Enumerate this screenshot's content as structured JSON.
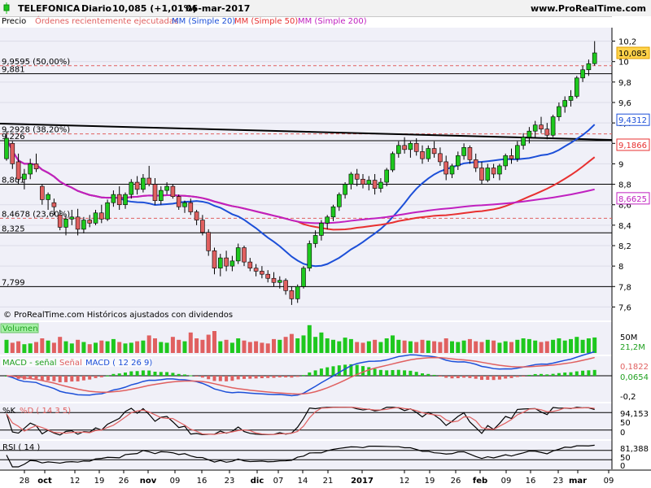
{
  "header": {
    "symbol": "TELEFONICA",
    "period": "Diario",
    "quote": "10,085 (+1,01%)",
    "date": "06-mar-2017",
    "site": "www.ProRealTime.com"
  },
  "price_legend": {
    "price": "Precio",
    "orders": "Órdenes recientemente ejecutadas",
    "ma20": "MM (Simple 20)",
    "ma50": "MM (Simple 50)",
    "ma200": "MM (Simple 200)"
  },
  "copyright": "© ProRealTime.com Históricos ajustados con dividendos",
  "colors": {
    "up": "#1ec81e",
    "down": "#e06060",
    "ma20": "#1c4fd8",
    "ma50": "#e83030",
    "ma200": "#c020c0",
    "volume": "#1ec81e",
    "grid": "#000000"
  },
  "levels": [
    {
      "text": "9,9595 (50,00%)",
      "value": 9.9595,
      "style": "dashed-red"
    },
    {
      "text": "9,881",
      "value": 9.881,
      "style": "solid-black"
    },
    {
      "text": "9,2928 (38,20%)",
      "value": 9.2928,
      "style": "dashed-red"
    },
    {
      "text": "9,226",
      "value": 9.226,
      "style": "solid-black"
    },
    {
      "text": "8,801",
      "value": 8.801,
      "style": "solid-black"
    },
    {
      "text": "8,4678 (23,60%)",
      "value": 8.4678,
      "style": "dashed-red"
    },
    {
      "text": "8,325",
      "value": 8.325,
      "style": "solid-black"
    },
    {
      "text": "7,799",
      "value": 7.799,
      "style": "solid-black"
    }
  ],
  "price_axis": {
    "ticks": [
      "10,2",
      "10",
      "9,8",
      "9,6",
      "9,4",
      "9,2",
      "9",
      "8,8",
      "8,6",
      "8,4",
      "8,2",
      "8",
      "7,8",
      "7,6"
    ],
    "values": [
      10.2,
      10.0,
      9.8,
      9.6,
      9.4,
      9.2,
      9.0,
      8.8,
      8.6,
      8.4,
      8.2,
      8.0,
      7.8,
      7.6
    ],
    "labels": [
      {
        "text": "10,085",
        "value": 10.085,
        "color": "#e0a000",
        "fill": "#ffd24a",
        "textcolor": "#000000"
      },
      {
        "text": "9,4312",
        "value": 9.4312,
        "color": "#1c4fd8",
        "fill": "#ffffff",
        "textcolor": "#1c4fd8"
      },
      {
        "text": "9,1866",
        "value": 9.1866,
        "color": "#e83030",
        "fill": "#ffffff",
        "textcolor": "#e83030"
      },
      {
        "text": "8,6625",
        "value": 8.6625,
        "color": "#c020c0",
        "fill": "#ffffff",
        "textcolor": "#c020c0"
      }
    ]
  },
  "volume": {
    "label": "Volumen",
    "tick": "50M",
    "value": "21,2M"
  },
  "macd": {
    "label_main": "MACD - señal",
    "label_signal": "Señal",
    "label_macd": "MACD ( 12 26 9)",
    "tick_zero": "0",
    "tick_neg": "-0,2",
    "value1": "0,1822",
    "value2": "0,0654"
  },
  "stoch": {
    "label_k": "%K",
    "label_d": "%D ( 14 3 5)",
    "value": "94,153",
    "tick_hi": "50",
    "tick_lo": "0"
  },
  "rsi": {
    "label": "RSI ( 14 )",
    "value": "81,388",
    "tick_hi": "50",
    "tick_lo": "0"
  },
  "date_axis": [
    "28",
    "oct",
    "12",
    "19",
    "26",
    "nov",
    "09",
    "16",
    "23",
    "dic",
    "07",
    "14",
    "21",
    "2017",
    "12",
    "19",
    "26",
    "feb",
    "09",
    "16",
    "23",
    "mar",
    "09"
  ],
  "chart_data": {
    "type": "candlestick",
    "ylim": [
      7.5,
      10.3
    ],
    "candles": [
      [
        9.05,
        9.32,
        9.03,
        9.25
      ],
      [
        9.2,
        9.22,
        8.95,
        9.0
      ],
      [
        9.02,
        9.1,
        8.8,
        8.85
      ],
      [
        8.85,
        8.95,
        8.75,
        8.9
      ],
      [
        8.9,
        9.05,
        8.85,
        9.0
      ],
      [
        9.0,
        9.1,
        8.92,
        8.95
      ],
      [
        8.78,
        8.8,
        8.6,
        8.65
      ],
      [
        8.65,
        8.72,
        8.55,
        8.7
      ],
      [
        8.62,
        8.66,
        8.5,
        8.58
      ],
      [
        8.5,
        8.55,
        8.35,
        8.38
      ],
      [
        8.38,
        8.5,
        8.3,
        8.46
      ],
      [
        8.46,
        8.55,
        8.4,
        8.48
      ],
      [
        8.48,
        8.56,
        8.3,
        8.36
      ],
      [
        8.36,
        8.48,
        8.32,
        8.45
      ],
      [
        8.45,
        8.5,
        8.38,
        8.42
      ],
      [
        8.42,
        8.55,
        8.4,
        8.52
      ],
      [
        8.52,
        8.6,
        8.42,
        8.46
      ],
      [
        8.46,
        8.65,
        8.44,
        8.62
      ],
      [
        8.62,
        8.74,
        8.58,
        8.7
      ],
      [
        8.7,
        8.78,
        8.55,
        8.6
      ],
      [
        8.6,
        8.72,
        8.56,
        8.7
      ],
      [
        8.7,
        8.85,
        8.66,
        8.82
      ],
      [
        8.82,
        8.88,
        8.7,
        8.75
      ],
      [
        8.75,
        8.9,
        8.72,
        8.86
      ],
      [
        8.86,
        8.98,
        8.78,
        8.8
      ],
      [
        8.8,
        8.86,
        8.6,
        8.64
      ],
      [
        8.64,
        8.78,
        8.6,
        8.74
      ],
      [
        8.74,
        8.82,
        8.7,
        8.78
      ],
      [
        8.78,
        8.8,
        8.66,
        8.68
      ],
      [
        8.68,
        8.7,
        8.55,
        8.58
      ],
      [
        8.58,
        8.64,
        8.52,
        8.62
      ],
      [
        8.62,
        8.66,
        8.5,
        8.53
      ],
      [
        8.53,
        8.55,
        8.4,
        8.45
      ],
      [
        8.45,
        8.5,
        8.3,
        8.33
      ],
      [
        8.33,
        8.36,
        8.1,
        8.15
      ],
      [
        8.15,
        8.18,
        7.92,
        7.98
      ],
      [
        7.98,
        8.12,
        7.9,
        8.08
      ],
      [
        8.08,
        8.15,
        7.95,
        8.0
      ],
      [
        8.0,
        8.1,
        7.95,
        8.05
      ],
      [
        8.05,
        8.22,
        8.02,
        8.18
      ],
      [
        8.18,
        8.2,
        8.0,
        8.04
      ],
      [
        8.04,
        8.08,
        7.95,
        7.98
      ],
      [
        7.98,
        8.02,
        7.9,
        7.95
      ],
      [
        7.95,
        8.0,
        7.88,
        7.92
      ],
      [
        7.92,
        7.96,
        7.84,
        7.88
      ],
      [
        7.88,
        7.94,
        7.8,
        7.84
      ],
      [
        7.84,
        7.9,
        7.78,
        7.86
      ],
      [
        7.86,
        7.88,
        7.72,
        7.76
      ],
      [
        7.76,
        7.8,
        7.62,
        7.68
      ],
      [
        7.68,
        7.82,
        7.64,
        7.8
      ],
      [
        7.8,
        8.0,
        7.78,
        7.98
      ],
      [
        7.98,
        8.25,
        7.95,
        8.22
      ],
      [
        8.22,
        8.35,
        8.18,
        8.3
      ],
      [
        8.3,
        8.45,
        8.25,
        8.42
      ],
      [
        8.42,
        8.5,
        8.36,
        8.48
      ],
      [
        8.48,
        8.6,
        8.44,
        8.58
      ],
      [
        8.58,
        8.72,
        8.54,
        8.7
      ],
      [
        8.7,
        8.82,
        8.66,
        8.8
      ],
      [
        8.8,
        8.92,
        8.75,
        8.9
      ],
      [
        8.9,
        8.95,
        8.78,
        8.85
      ],
      [
        8.85,
        8.9,
        8.76,
        8.8
      ],
      [
        8.8,
        8.88,
        8.74,
        8.84
      ],
      [
        8.84,
        8.9,
        8.7,
        8.76
      ],
      [
        8.76,
        8.86,
        8.72,
        8.82
      ],
      [
        8.82,
        8.96,
        8.78,
        8.94
      ],
      [
        8.94,
        9.12,
        8.92,
        9.1
      ],
      [
        9.1,
        9.22,
        9.06,
        9.18
      ],
      [
        9.18,
        9.26,
        9.1,
        9.14
      ],
      [
        9.14,
        9.22,
        9.06,
        9.2
      ],
      [
        9.2,
        9.25,
        9.08,
        9.12
      ],
      [
        9.12,
        9.18,
        9.0,
        9.05
      ],
      [
        9.05,
        9.18,
        9.02,
        9.15
      ],
      [
        9.15,
        9.22,
        9.06,
        9.1
      ],
      [
        9.1,
        9.16,
        8.98,
        9.02
      ],
      [
        9.02,
        9.08,
        8.84,
        8.9
      ],
      [
        8.9,
        9.0,
        8.86,
        8.98
      ],
      [
        8.98,
        9.12,
        8.94,
        9.08
      ],
      [
        9.08,
        9.2,
        9.04,
        9.16
      ],
      [
        9.16,
        9.18,
        9.0,
        9.04
      ],
      [
        9.04,
        9.1,
        8.92,
        8.96
      ],
      [
        8.96,
        9.02,
        8.8,
        8.84
      ],
      [
        8.84,
        9.0,
        8.82,
        8.96
      ],
      [
        8.96,
        9.0,
        8.86,
        8.9
      ],
      [
        8.9,
        9.0,
        8.84,
        8.98
      ],
      [
        8.98,
        9.1,
        8.94,
        9.08
      ],
      [
        9.08,
        9.15,
        9.0,
        9.05
      ],
      [
        9.05,
        9.22,
        9.02,
        9.18
      ],
      [
        9.18,
        9.3,
        9.14,
        9.26
      ],
      [
        9.26,
        9.36,
        9.2,
        9.32
      ],
      [
        9.32,
        9.42,
        9.26,
        9.38
      ],
      [
        9.38,
        9.46,
        9.3,
        9.34
      ],
      [
        9.34,
        9.4,
        9.24,
        9.28
      ],
      [
        9.28,
        9.48,
        9.26,
        9.46
      ],
      [
        9.46,
        9.6,
        9.42,
        9.56
      ],
      [
        9.56,
        9.66,
        9.5,
        9.62
      ],
      [
        9.62,
        9.72,
        9.56,
        9.66
      ],
      [
        9.66,
        9.86,
        9.64,
        9.84
      ],
      [
        9.84,
        9.96,
        9.8,
        9.92
      ],
      [
        9.92,
        10.02,
        9.86,
        9.98
      ],
      [
        9.98,
        10.2,
        9.96,
        10.085
      ]
    ],
    "volume": [
      18,
      14,
      16,
      12,
      13,
      15,
      20,
      17,
      14,
      22,
      16,
      13,
      18,
      15,
      12,
      14,
      17,
      16,
      19,
      15,
      13,
      14,
      16,
      17,
      24,
      20,
      15,
      14,
      22,
      18,
      16,
      28,
      20,
      18,
      25,
      30,
      16,
      18,
      14,
      20,
      17,
      15,
      16,
      14,
      13,
      19,
      18,
      22,
      26,
      20,
      24,
      38,
      22,
      28,
      20,
      18,
      16,
      21,
      19,
      15,
      14,
      16,
      18,
      15,
      20,
      24,
      18,
      17,
      16,
      15,
      18,
      17,
      16,
      15,
      20,
      16,
      15,
      17,
      19,
      16,
      15,
      18,
      17,
      14,
      16,
      15,
      18,
      20,
      19,
      17,
      15,
      16,
      18,
      20,
      17,
      19,
      22,
      18,
      20,
      21.2
    ],
    "series_labels": [
      "MM (Simple 20)",
      "MM (Simple 50)",
      "MM (Simple 200)"
    ]
  }
}
